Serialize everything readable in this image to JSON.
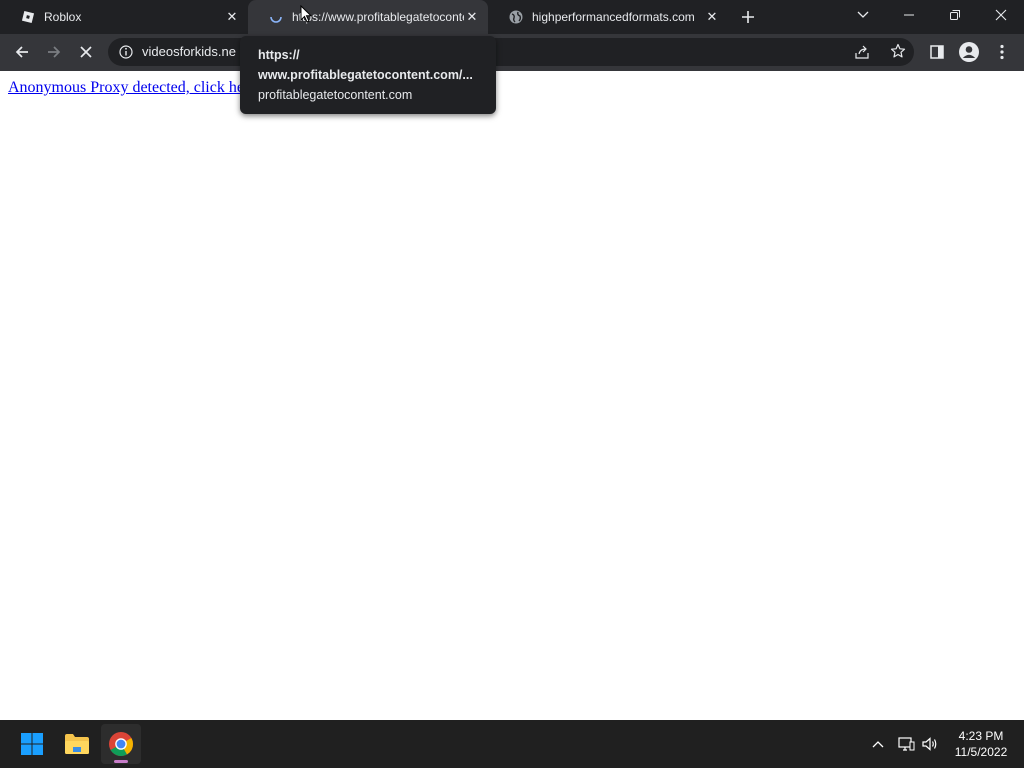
{
  "browser": {
    "tabs": [
      {
        "title": "Roblox",
        "favicon": "roblox-icon",
        "active": false
      },
      {
        "title": "https://www.profitablegatetocontent.com/",
        "favicon": "loading-spinner-icon",
        "active": true
      },
      {
        "title": "highperformancedformats.com",
        "favicon": "globe-icon",
        "active": false
      }
    ],
    "address_bar": {
      "url": "videosforkids.ne"
    },
    "tooltip": {
      "line1": "https://",
      "line2": "www.profitablegatetocontent.com/...",
      "line3": "profitablegatetocontent.com"
    }
  },
  "page": {
    "link_text": "Anonymous Proxy detected, click he"
  },
  "taskbar": {
    "time": "4:23 PM",
    "date": "11/5/2022"
  },
  "colors": {
    "tabstrip": "#202124",
    "toolbar": "#35363a",
    "link": "#0000ee",
    "taskbar": "#202020"
  }
}
